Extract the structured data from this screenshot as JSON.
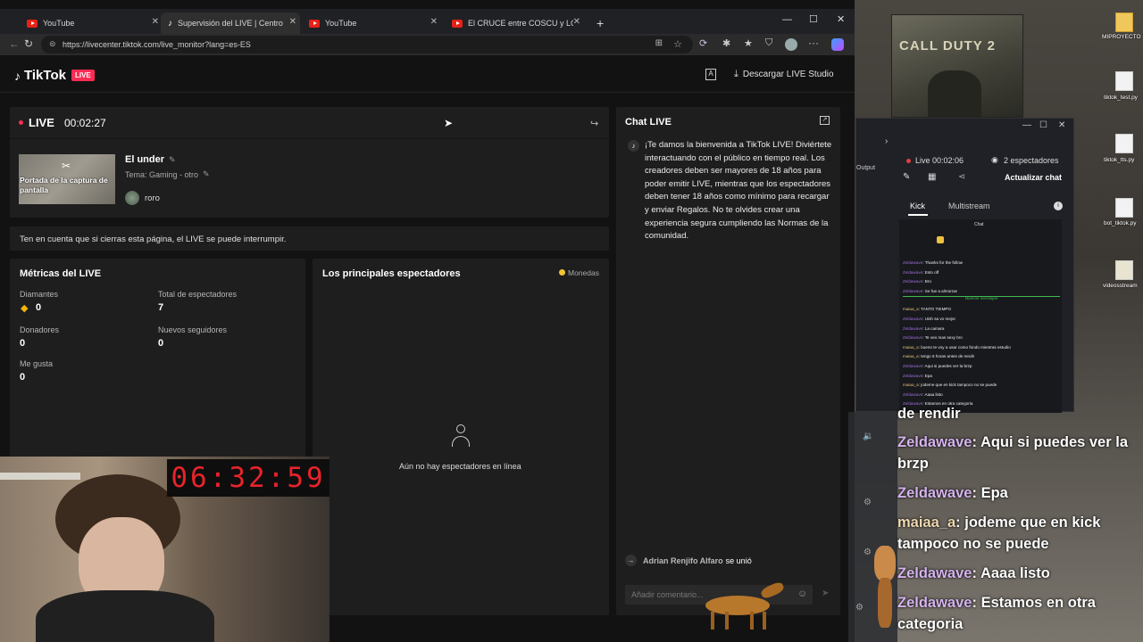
{
  "browser": {
    "tabs": [
      {
        "title": "YouTube",
        "icon": "youtube-icon"
      },
      {
        "title": "Supervisión del LIVE | Centro LIVE",
        "icon": "tiktok-icon"
      },
      {
        "title": "YouTube",
        "icon": "youtube-icon"
      },
      {
        "title": "El CRUCE entre COSCU y LOLO M",
        "icon": "youtube-icon"
      }
    ],
    "new_tab": "+",
    "url": "https://livecenter.tiktok.com/live_monitor?lang=es-ES"
  },
  "header": {
    "logo": "TikTok",
    "live_badge": "LIVE",
    "download_label": "Descargar LIVE Studio"
  },
  "live": {
    "status": "LIVE",
    "timer": "00:02:27",
    "thumbnail_text": "Portada de la captura de pantalla",
    "title": "El under",
    "topic": "Tema: Gaming - otro",
    "user": "roro",
    "warning": "Ten en cuenta que si cierras esta página, el LIVE se puede interrumpir."
  },
  "metrics": {
    "title": "Métricas del LIVE",
    "items": [
      {
        "label": "Diamantes",
        "value": "0"
      },
      {
        "label": "Total de espectadores",
        "value": "7"
      },
      {
        "label": "Donadores",
        "value": "0"
      },
      {
        "label": "Nuevos seguidores",
        "value": "0"
      },
      {
        "label": "Me gusta",
        "value": "0"
      }
    ]
  },
  "viewers": {
    "title": "Los principales espectadores",
    "coins": "Monedas",
    "empty": "Aún no hay espectadores en línea"
  },
  "chat": {
    "title": "Chat LIVE",
    "welcome": "¡Te damos la bienvenida a TikTok LIVE! Diviértete interactuando con el público en tiempo real. Los creadores deben ser mayores de 18 años para poder emitir LIVE, mientras que los espectadores deben tener 18 años como mínimo para recargar y enviar Regalos. No te olvides crear una experiencia segura cumpliendo las Normas de la comunidad.",
    "join_user": "Adrian Renjifo Alfaro",
    "join_text": "se unió",
    "input_placeholder": "Añadir comentario..."
  },
  "obs": {
    "live_time": "Live 00:02:06",
    "viewers": "2 espectadores",
    "update": "Actualizar chat",
    "tab_kick": "Kick",
    "tab_multistream": "Multistream",
    "chat_label": "Chat",
    "output": "Output",
    "messages": [
      {
        "user": "Zeldawave",
        "text": "Thanks for the follow"
      },
      {
        "user": "Zeldawave",
        "text": "Esto off"
      },
      {
        "user": "Zeldawave",
        "text": "Bro"
      },
      {
        "user": "Zeldawave",
        "text": "Se fue a almorzar"
      },
      {
        "user": "maiaa_a",
        "text": "TANTO TIEMPO"
      },
      {
        "user": "Zeldawave",
        "text": "Uish sa vo mejor"
      },
      {
        "user": "Zeldawave",
        "text": "La camara"
      },
      {
        "user": "Zeldawave",
        "text": "Te veo mas sexy bro"
      },
      {
        "user": "maiaa_a",
        "text": "bueno te voy a usar como fondo mientras estudio"
      },
      {
        "user": "maiaa_a",
        "text": "tengo 6 horas antes de rendir"
      },
      {
        "user": "Zeldawave",
        "text": "Aqui si puedes ver la brzp"
      },
      {
        "user": "Zeldawave",
        "text": "Epa"
      },
      {
        "user": "maiaa_a",
        "text": "jodeme que en kick tampoco no se puede"
      },
      {
        "user": "Zeldawave",
        "text": "Aaaa listo"
      },
      {
        "user": "Zeldawave",
        "text": "Estamos en otra categoria"
      }
    ],
    "new_messages": "Nuevos mensajes"
  },
  "overlay_chat": [
    {
      "user": "",
      "text": "de rendir"
    },
    {
      "user": "Zeldawave",
      "text": "Aqui si puedes ver la brzp"
    },
    {
      "user": "Zeldawave",
      "text": "Epa"
    },
    {
      "user": "maiaa_a",
      "text": "jodeme que en kick tampoco no se puede"
    },
    {
      "user": "Zeldawave",
      "text": "Aaaa listo"
    },
    {
      "user": "Zeldawave",
      "text": "Estamos en otra categoria"
    }
  ],
  "desktop": {
    "icons": [
      "MIPROYECTO",
      "tiktok_test.py",
      "tiktok_tts.py",
      "bot_tiktok.py",
      "videosstream"
    ],
    "poster_text": "CALL DUTY 2"
  },
  "stream_timer": "06:32:59"
}
